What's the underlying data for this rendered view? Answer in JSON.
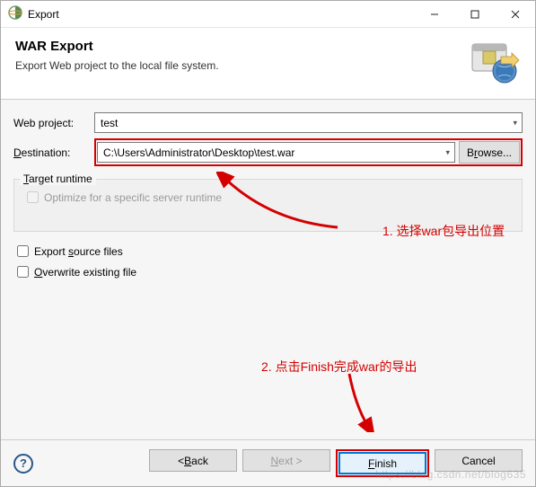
{
  "titlebar": {
    "title": "Export"
  },
  "banner": {
    "heading": "WAR Export",
    "subtitle": "Export Web project to the local file system."
  },
  "form": {
    "web_project_label": "Web project:",
    "web_project_value": "test",
    "destination_label_pre": "",
    "destination_label_u": "D",
    "destination_label_post": "estination:",
    "destination_value": "C:\\Users\\Administrator\\Desktop\\test.war",
    "browse_label_pre": "B",
    "browse_label_u": "r",
    "browse_label_post": "owse..."
  },
  "group": {
    "title_u": "T",
    "title_post": "arget runtime",
    "optimize_label": "Optimize for a specific server runtime"
  },
  "checks": {
    "export_source_pre": "Export ",
    "export_source_u": "s",
    "export_source_post": "ource files",
    "overwrite_pre": "",
    "overwrite_u": "O",
    "overwrite_post": "verwrite existing file"
  },
  "footer": {
    "back_pre": "< ",
    "back_u": "B",
    "back_post": "ack",
    "next_u": "N",
    "next_post": "ext >",
    "finish_u": "F",
    "finish_post": "inish",
    "cancel": "Cancel"
  },
  "annotations": {
    "a1": "1. 选择war包导出位置",
    "a2": "2. 点击Finish完成war的导出"
  },
  "watermark": "https://blog.csdn.net/blog635"
}
